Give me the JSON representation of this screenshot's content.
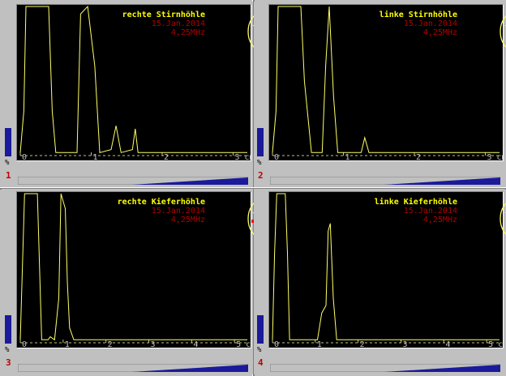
{
  "colors": {
    "trace": "#ffff66",
    "title": "#ffff00",
    "date": "#b00000",
    "gain_bar": "#1a1a9a",
    "channel_number": "#c00000"
  },
  "panels": [
    {
      "channel": "1",
      "title": "rechte Stirnhöhle",
      "date": "15.Jan.2014",
      "freq": "4,25MHz",
      "percent_label": "%",
      "gain_level": 0.19,
      "axis_ticks": [
        "0",
        "1",
        "2",
        "3 cm"
      ],
      "face_marker": "right-forehead",
      "chart_data": {
        "type": "line",
        "x_range_cm": [
          0,
          3.2
        ],
        "y_range": [
          0,
          1
        ],
        "points": [
          [
            0,
            0.02
          ],
          [
            0.05,
            0.3
          ],
          [
            0.08,
            1
          ],
          [
            0.4,
            1
          ],
          [
            0.45,
            0.3
          ],
          [
            0.5,
            0.02
          ],
          [
            0.8,
            0.02
          ],
          [
            0.85,
            0.95
          ],
          [
            0.95,
            1
          ],
          [
            1.05,
            0.6
          ],
          [
            1.12,
            0.02
          ],
          [
            1.28,
            0.04
          ],
          [
            1.35,
            0.2
          ],
          [
            1.42,
            0.02
          ],
          [
            1.58,
            0.04
          ],
          [
            1.62,
            0.18
          ],
          [
            1.66,
            0.02
          ],
          [
            3.2,
            0.02
          ]
        ]
      }
    },
    {
      "channel": "2",
      "title": "linke Stirnhöhle",
      "date": "15.Jan.2014",
      "freq": "4,25MHz",
      "percent_label": "%",
      "gain_level": 0.19,
      "axis_ticks": [
        "0",
        "1",
        "2",
        "3 cm"
      ],
      "face_marker": "right-forehead",
      "chart_data": {
        "type": "line",
        "x_range_cm": [
          0,
          3.2
        ],
        "y_range": [
          0,
          1
        ],
        "points": [
          [
            0,
            0.02
          ],
          [
            0.05,
            0.3
          ],
          [
            0.08,
            1
          ],
          [
            0.4,
            1
          ],
          [
            0.45,
            0.5
          ],
          [
            0.55,
            0.02
          ],
          [
            0.7,
            0.02
          ],
          [
            0.75,
            0.6
          ],
          [
            0.8,
            1
          ],
          [
            0.86,
            0.4
          ],
          [
            0.92,
            0.02
          ],
          [
            1.25,
            0.02
          ],
          [
            1.3,
            0.12
          ],
          [
            1.36,
            0.02
          ],
          [
            3.2,
            0.02
          ]
        ]
      }
    },
    {
      "channel": "3",
      "title": "rechte Kieferhöhle",
      "date": "15.Jan.2014",
      "freq": "4,25MHz",
      "percent_label": "%",
      "gain_level": 0.19,
      "axis_ticks": [
        "0",
        "1",
        "2",
        "3",
        "4",
        "5 cm"
      ],
      "face_marker": "right-cheek",
      "chart_data": {
        "type": "line",
        "x_range_cm": [
          0,
          5.3
        ],
        "y_range": [
          0,
          1
        ],
        "points": [
          [
            0,
            0.02
          ],
          [
            0.05,
            0.5
          ],
          [
            0.1,
            1
          ],
          [
            0.4,
            1
          ],
          [
            0.45,
            0.5
          ],
          [
            0.5,
            0.02
          ],
          [
            0.65,
            0.02
          ],
          [
            0.7,
            0.04
          ],
          [
            0.8,
            0.02
          ],
          [
            0.9,
            0.3
          ],
          [
            0.95,
            1
          ],
          [
            1.05,
            0.9
          ],
          [
            1.1,
            0.4
          ],
          [
            1.15,
            0.1
          ],
          [
            1.25,
            0.02
          ],
          [
            5.3,
            0.02
          ]
        ]
      }
    },
    {
      "channel": "4",
      "title": "linke Kieferhöhle",
      "date": "15.Jan.2014",
      "freq": "4,25MHz",
      "percent_label": "%",
      "gain_level": 0.19,
      "axis_ticks": [
        "0",
        "1",
        "2",
        "3",
        "4",
        "5 cm"
      ],
      "face_marker": "left-cheek",
      "chart_data": {
        "type": "line",
        "x_range_cm": [
          0,
          5.3
        ],
        "y_range": [
          0,
          1
        ],
        "points": [
          [
            0,
            0.02
          ],
          [
            0.05,
            0.6
          ],
          [
            0.1,
            1
          ],
          [
            0.3,
            1
          ],
          [
            0.35,
            0.6
          ],
          [
            0.4,
            0.02
          ],
          [
            1.05,
            0.02
          ],
          [
            1.15,
            0.2
          ],
          [
            1.25,
            0.25
          ],
          [
            1.3,
            0.75
          ],
          [
            1.35,
            0.8
          ],
          [
            1.42,
            0.3
          ],
          [
            1.5,
            0.02
          ],
          [
            5.3,
            0.02
          ]
        ]
      }
    }
  ]
}
